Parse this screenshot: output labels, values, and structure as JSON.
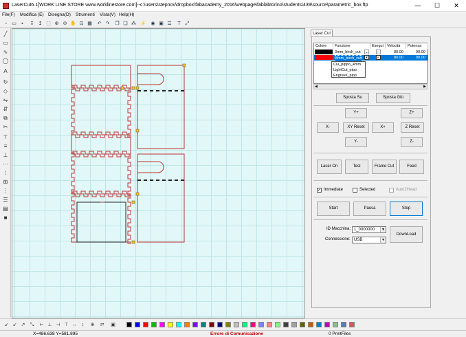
{
  "window": {
    "title": "LaserCut6.1[WORK LINE STORE www.worklinestore.com]--c:\\users\\stepnov\\dropbox\\fabacademy_2016\\webpage\\fablabtorino\\students\\439\\source\\parametric_box.ftp",
    "minimize": "—",
    "maximize": "☐",
    "close": "✕"
  },
  "menu": [
    "File(F)",
    "Modifica (E)",
    "Disegna(D)",
    "Strumenti",
    "Vista(V)",
    "Help(H)"
  ],
  "panel": {
    "tab": "Laser Cut",
    "layers": {
      "headers": [
        "Colore",
        "Funzione",
        "Esegui",
        "Velocità",
        "Potenza"
      ],
      "rows": [
        {
          "color": "#000000",
          "function": "3mm_birch_cut",
          "execute": true,
          "speed": "80.00",
          "power": "90.00"
        },
        {
          "color": "#ff0000",
          "function": "3mm_birch_cut",
          "execute": true,
          "speed": "80.00",
          "power": "90.00"
        }
      ],
      "dropdown_options": [
        "Ciu_pippo_4mm",
        "LightCut_pipp",
        "Engrave_pipp"
      ]
    },
    "buttons": {
      "move_up": "Sposta Su",
      "move_down": "Sposta Giù",
      "y_plus": "Y+",
      "z_plus": "Z+",
      "x_minus": "X-",
      "xy_reset": "XY Reset",
      "x_plus": "X+",
      "z_reset": "Z Reset",
      "y_minus": "Y-",
      "z_minus": "Z-",
      "laser_on": "Laser On",
      "test": "Test",
      "frame_cut": "Frame Cut",
      "feed": "Feed",
      "start": "Start",
      "pause": "Pausa",
      "stop": "Stop",
      "download": "DownLoad"
    },
    "options": {
      "immediate": {
        "label": "Immediate",
        "checked": true
      },
      "selected": {
        "label": "Selected",
        "checked": false
      },
      "auto2head": {
        "label": "Auto2Head",
        "checked": false
      }
    },
    "machine_id_label": "ID Macchina:",
    "machine_id_value": "1_0000000",
    "connection_label": "Connessione:",
    "connection_value": "USB"
  },
  "status": {
    "coords": "X=486.638 Y=581.895",
    "message": "Errore di Comunicazione",
    "message_color": "#cc0000",
    "printfiles": "0 PrintFiles"
  },
  "palette": [
    "#000000",
    "#0000ff",
    "#ff0000",
    "#00c000",
    "#ff00ff",
    "#ffff00",
    "#00ffff",
    "#ff8000",
    "#8000ff",
    "#008080",
    "#800000",
    "#000080",
    "#808000",
    "#c0c0c0",
    "#00ff80",
    "#ff0080",
    "#8080ff",
    "#ff8080",
    "#80ff80",
    "#404040",
    "#a0a0a0",
    "#606000",
    "#c06000",
    "#0080c0",
    "#c000c0",
    "#8fbc8f",
    "#4682b4",
    "#cd5c5c"
  ]
}
